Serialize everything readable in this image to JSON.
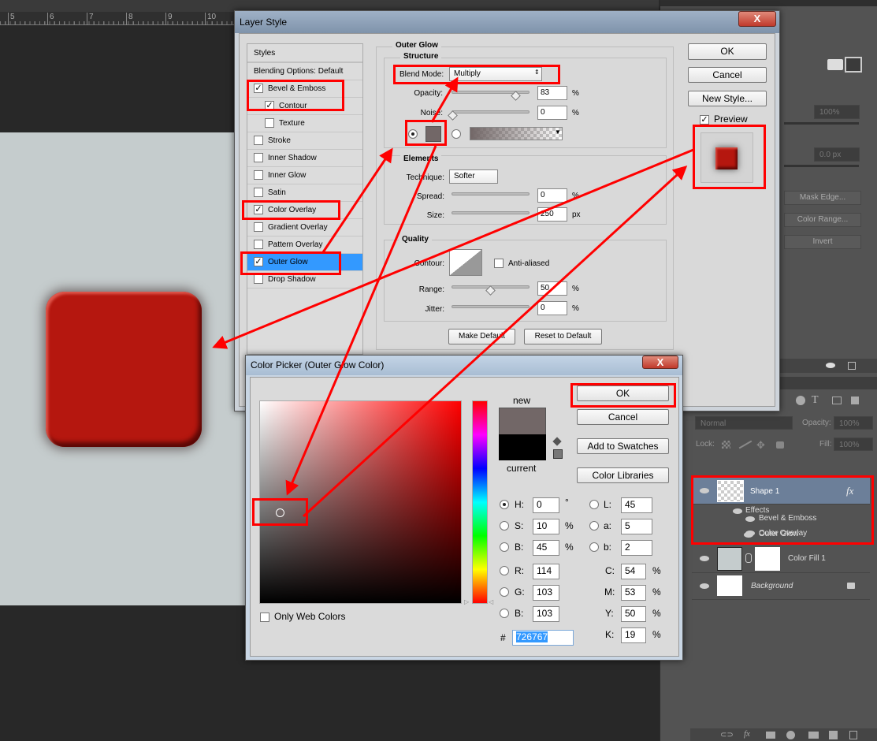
{
  "ruler": {
    "labels": [
      "5",
      "6",
      "7",
      "8",
      "9",
      "10"
    ]
  },
  "properties_panel": {
    "opacity_value": "100%",
    "feather_value": "0.0 px",
    "buttons": [
      "Mask Edge...",
      "Color Range...",
      "Invert"
    ]
  },
  "layers_panel": {
    "blend_mode": "Normal",
    "opacity_label": "Opacity:",
    "opacity_value": "100%",
    "lock_label": "Lock:",
    "fill_label": "Fill:",
    "fill_value": "100%",
    "layers": [
      {
        "name": "Shape 1",
        "selected": true,
        "fx": "fx",
        "effects_label": "Effects",
        "effects": [
          "Bevel & Emboss",
          "Color Overlay",
          "Outer Glow"
        ]
      },
      {
        "name": "Color Fill 1"
      },
      {
        "name": "Background",
        "locked": true
      }
    ]
  },
  "layer_style": {
    "title": "Layer Style",
    "close": "X",
    "styles_header": "Styles",
    "blending_options": "Blending Options: Default",
    "styles": [
      {
        "label": "Bevel & Emboss",
        "checked": true
      },
      {
        "label": "Contour",
        "checked": true
      },
      {
        "label": "Texture",
        "checked": false
      },
      {
        "label": "Stroke",
        "checked": false
      },
      {
        "label": "Inner Shadow",
        "checked": false
      },
      {
        "label": "Inner Glow",
        "checked": false
      },
      {
        "label": "Satin",
        "checked": false
      },
      {
        "label": "Color Overlay",
        "checked": true
      },
      {
        "label": "Gradient Overlay",
        "checked": false
      },
      {
        "label": "Pattern Overlay",
        "checked": false
      },
      {
        "label": "Outer Glow",
        "checked": true,
        "selected": true
      },
      {
        "label": "Drop Shadow",
        "checked": false
      }
    ],
    "section_title": "Outer Glow",
    "structure": {
      "title": "Structure",
      "blend_mode_label": "Blend Mode:",
      "blend_mode": "Multiply",
      "opacity_label": "Opacity:",
      "opacity": "83",
      "noise_label": "Noise:",
      "noise": "0",
      "unit": "%",
      "glow_color": "#726767"
    },
    "elements": {
      "title": "Elements",
      "technique_label": "Technique:",
      "technique": "Softer",
      "spread_label": "Spread:",
      "spread": "0",
      "size_label": "Size:",
      "size": "250",
      "size_unit": "px",
      "unit": "%"
    },
    "quality": {
      "title": "Quality",
      "contour_label": "Contour:",
      "anti_aliased": "Anti-aliased",
      "range_label": "Range:",
      "range": "50",
      "jitter_label": "Jitter:",
      "jitter": "0",
      "unit": "%"
    },
    "make_default": "Make Default",
    "reset_default": "Reset to Default",
    "ok": "OK",
    "cancel": "Cancel",
    "new_style": "New Style...",
    "preview": "Preview"
  },
  "color_picker": {
    "title": "Color Picker (Outer Glow Color)",
    "close": "X",
    "new_label": "new",
    "current_label": "current",
    "new_color": "#726767",
    "current_color": "#000000",
    "ok": "OK",
    "cancel": "Cancel",
    "add_swatches": "Add to Swatches",
    "color_libraries": "Color Libraries",
    "only_web": "Only Web Colors",
    "fields": {
      "H": "0",
      "S": "10",
      "B": "45",
      "R": "114",
      "G": "103",
      "Bv": "103",
      "L": "45",
      "a": "5",
      "b": "2",
      "C": "54",
      "M": "53",
      "Y": "50",
      "K": "19",
      "hex": "726767"
    },
    "labels": {
      "H": "H:",
      "S": "S:",
      "B": "B:",
      "R": "R:",
      "G": "G:",
      "Bv": "B:",
      "L": "L:",
      "a": "a:",
      "b": "b:",
      "C": "C:",
      "M": "M:",
      "Y": "Y:",
      "K": "K:",
      "hash": "#",
      "deg": "°",
      "pct": "%"
    }
  },
  "annotation_color": "#ff0000"
}
